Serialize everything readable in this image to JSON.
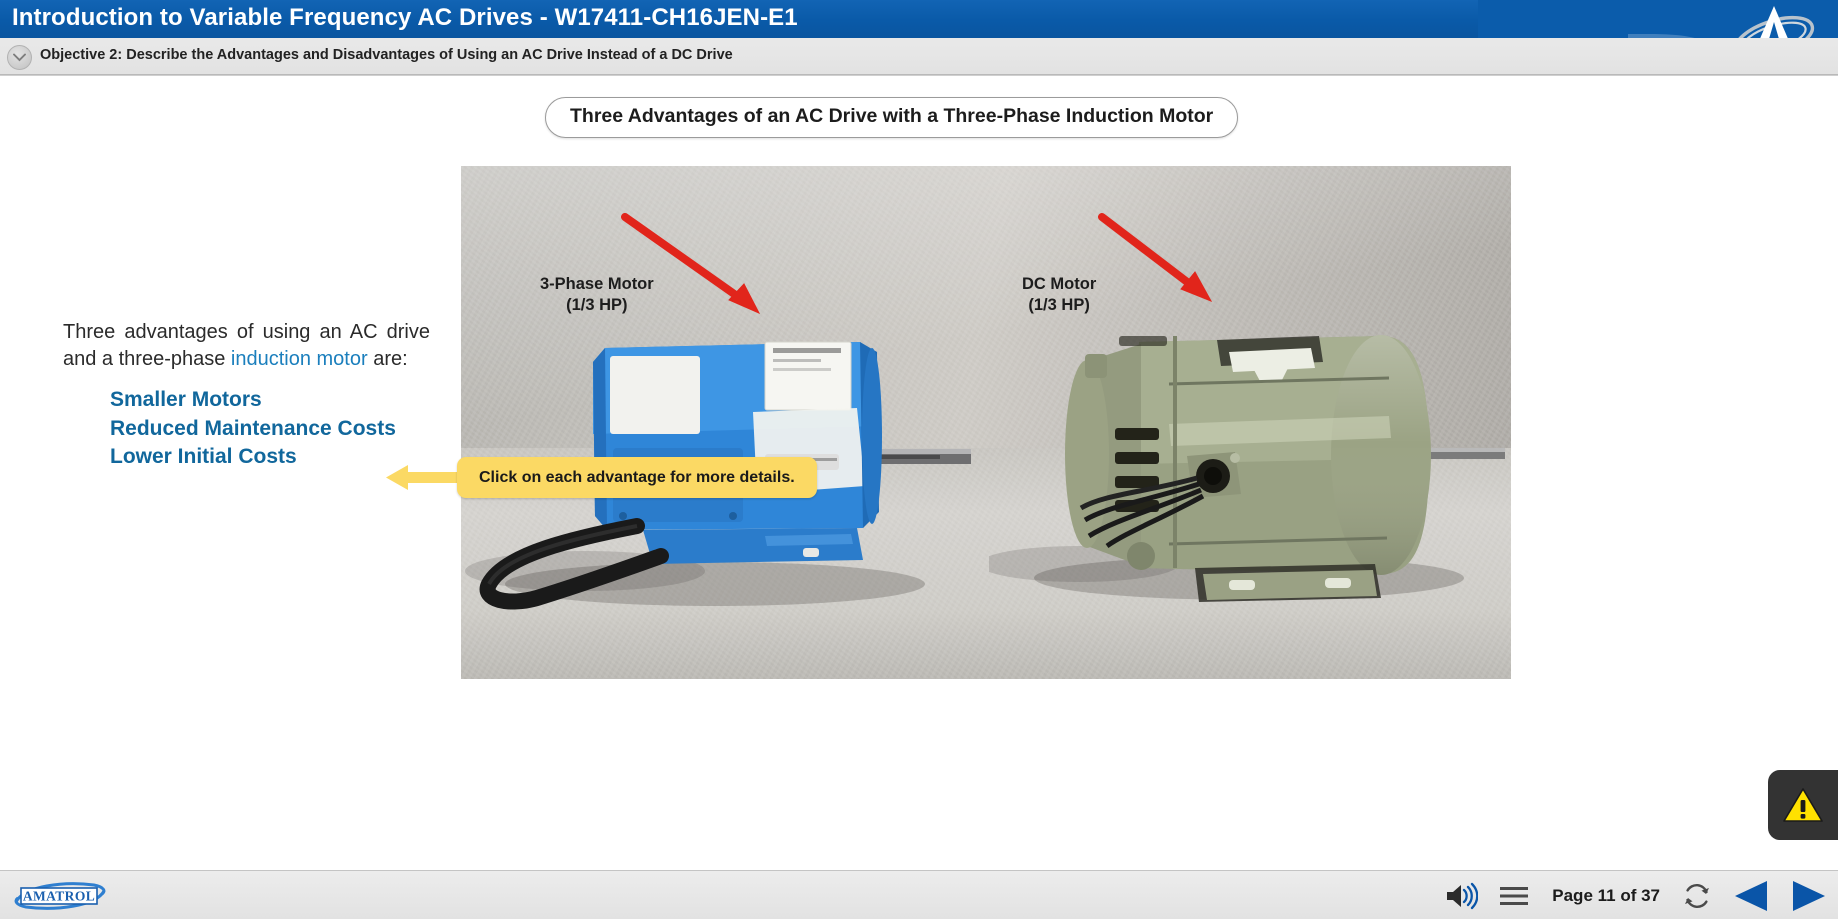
{
  "titlebar": {
    "title": "Introduction to Variable Frequency AC Drives - W17411-CH16JEN-E1",
    "brand_logo": "amatrol-a-logo",
    "bg_color": "#0b5cab"
  },
  "objective_bar": {
    "collapse_icon": "chevron-down-icon",
    "text": "Objective 2: Describe the Advantages and Disadvantages of Using an AC Drive Instead of a DC Drive"
  },
  "main": {
    "page_title": "Three Advantages of an AC Drive with a Three-Phase Induction Motor",
    "paragraph": {
      "part1": "Three advantages of using an AC drive and a three-phase ",
      "link": "induction motor",
      "part2": " are:"
    },
    "advantages": [
      {
        "label": "Smaller Motors"
      },
      {
        "label": "Reduced Maintenance Costs"
      },
      {
        "label": "Lower Initial Costs"
      }
    ],
    "callout": {
      "text": "Click on each advantage for more details.",
      "bg_color": "#fbd964"
    },
    "photo": {
      "labels": [
        {
          "line1": "3-Phase Motor",
          "line2": "(1/3 HP)"
        },
        {
          "line1": "DC Motor",
          "line2": "(1/3 HP)"
        }
      ],
      "arrow_color": "#e1251b",
      "ac_motor_color": "#2a7fd4",
      "dc_motor_color": "#9aa086"
    }
  },
  "warning_badge": {
    "icon": "warning-triangle-icon",
    "bg_color": "#333333",
    "triangle_color": "#ffe100"
  },
  "bottombar": {
    "logo_text": "AMATROL",
    "audio_icon": "speaker-volume-icon",
    "menu_icon": "hamburger-menu-icon",
    "page_label": "Page 11 of 37",
    "refresh_icon": "refresh-icon",
    "prev_icon": "previous-triangle-icon",
    "next_icon": "next-triangle-icon",
    "nav_color": "#0a55a8"
  }
}
